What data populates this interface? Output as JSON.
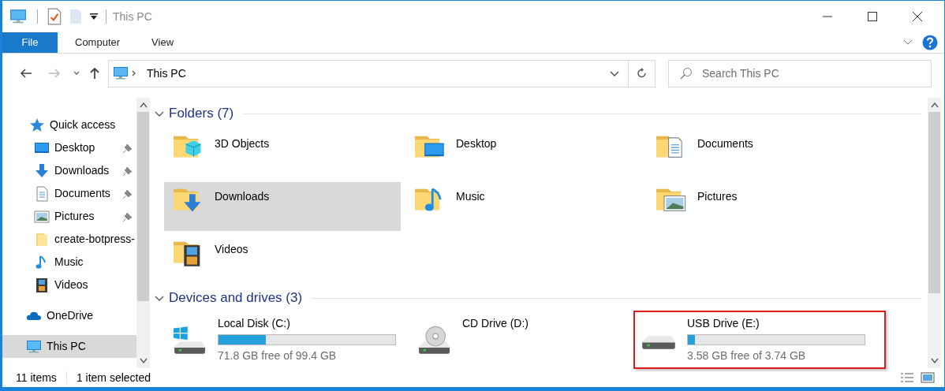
{
  "window": {
    "title": "This PC"
  },
  "ribbon": {
    "tabs": [
      {
        "label": "File",
        "kind": "file",
        "selected": false
      },
      {
        "label": "Computer",
        "kind": "tab",
        "selected": false
      },
      {
        "label": "View",
        "kind": "tab",
        "selected": false
      }
    ]
  },
  "address_bar": {
    "path": "This PC"
  },
  "search": {
    "placeholder": "Search This PC"
  },
  "sidebar": {
    "items": [
      {
        "label": "Quick access",
        "kind": "star",
        "selected": false,
        "pinned": false,
        "children": [
          {
            "label": "Desktop",
            "kind": "desktop",
            "selected": false,
            "pinned": true
          },
          {
            "label": "Downloads",
            "kind": "downloads",
            "selected": false,
            "pinned": true
          },
          {
            "label": "Documents",
            "kind": "documents",
            "selected": false,
            "pinned": true
          },
          {
            "label": "Pictures",
            "kind": "pictures",
            "selected": false,
            "pinned": true
          },
          {
            "label": "create-botpress-",
            "kind": "folder",
            "selected": false,
            "pinned": false
          },
          {
            "label": "Music",
            "kind": "music",
            "selected": false,
            "pinned": false
          },
          {
            "label": "Videos",
            "kind": "videos",
            "selected": false,
            "pinned": false
          }
        ]
      },
      {
        "label": "OneDrive",
        "kind": "cloud",
        "selected": false,
        "pinned": false
      },
      {
        "label": "This PC",
        "kind": "monitor",
        "selected": true,
        "pinned": false
      }
    ]
  },
  "sections": [
    {
      "title": "Folders (7)",
      "kind": "folders",
      "expanded": true,
      "items": [
        {
          "label": "3D Objects",
          "kind": "cube",
          "selected": false
        },
        {
          "label": "Desktop",
          "kind": "desktop",
          "selected": false
        },
        {
          "label": "Documents",
          "kind": "documents",
          "selected": false
        },
        {
          "label": "Downloads",
          "kind": "downloads",
          "selected": true
        },
        {
          "label": "Music",
          "kind": "music",
          "selected": false
        },
        {
          "label": "Pictures",
          "kind": "pictures",
          "selected": false
        },
        {
          "label": "Videos",
          "kind": "videos",
          "selected": false
        }
      ]
    },
    {
      "title": "Devices and drives (3)",
      "kind": "drives",
      "expanded": true,
      "items": [
        {
          "label": "Local Disk (C:)",
          "kind": "system-disk",
          "level": 0.27,
          "free": "71.8 GB free of 99.4 GB",
          "highlighted": false
        },
        {
          "label": "CD Drive (D:)",
          "kind": "cd",
          "highlighted": false
        },
        {
          "label": "USB Drive (E:)",
          "kind": "disk",
          "level": 0.04,
          "free": "3.58 GB free of 3.74 GB",
          "highlighted": true
        }
      ]
    }
  ],
  "status_bar": {
    "count": "11 items",
    "selection": "1 item selected"
  }
}
